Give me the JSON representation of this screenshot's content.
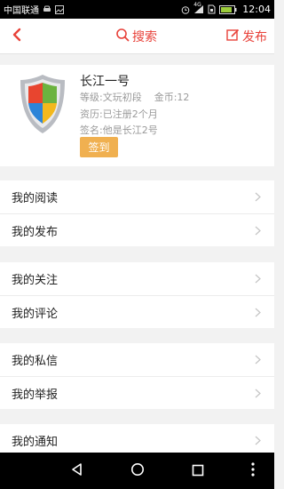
{
  "status_bar": {
    "carrier": "中国联通",
    "time": "12:04",
    "network": "4G",
    "icons": [
      "car-icon",
      "image-icon",
      "alarm-icon",
      "signal-icon",
      "sim-icon",
      "battery-icon"
    ]
  },
  "header": {
    "back_icon": "chevron-left-icon",
    "search_label": "搜索",
    "publish_label": "发布",
    "accent_color": "#e8423a"
  },
  "profile": {
    "avatar_icon": "shield-icon",
    "name": "长江一号",
    "level": "等级:文玩初段",
    "coins": "金币:12",
    "history": "资历:已注册2个月",
    "signature": "签名:他是长江2号",
    "checkin_label": "签到",
    "checkin_color": "#f0b050"
  },
  "menu_groups": [
    {
      "items": [
        {
          "label": "我的阅读"
        },
        {
          "label": "我的发布"
        }
      ]
    },
    {
      "items": [
        {
          "label": "我的关注"
        },
        {
          "label": "我的评论"
        }
      ]
    },
    {
      "items": [
        {
          "label": "我的私信"
        },
        {
          "label": "我的举报"
        }
      ]
    },
    {
      "items": [
        {
          "label": "我的通知"
        }
      ]
    }
  ],
  "nav_bar": {
    "icons": [
      "back-triangle-icon",
      "home-circle-icon",
      "recents-square-icon",
      "more-dots-icon"
    ]
  }
}
